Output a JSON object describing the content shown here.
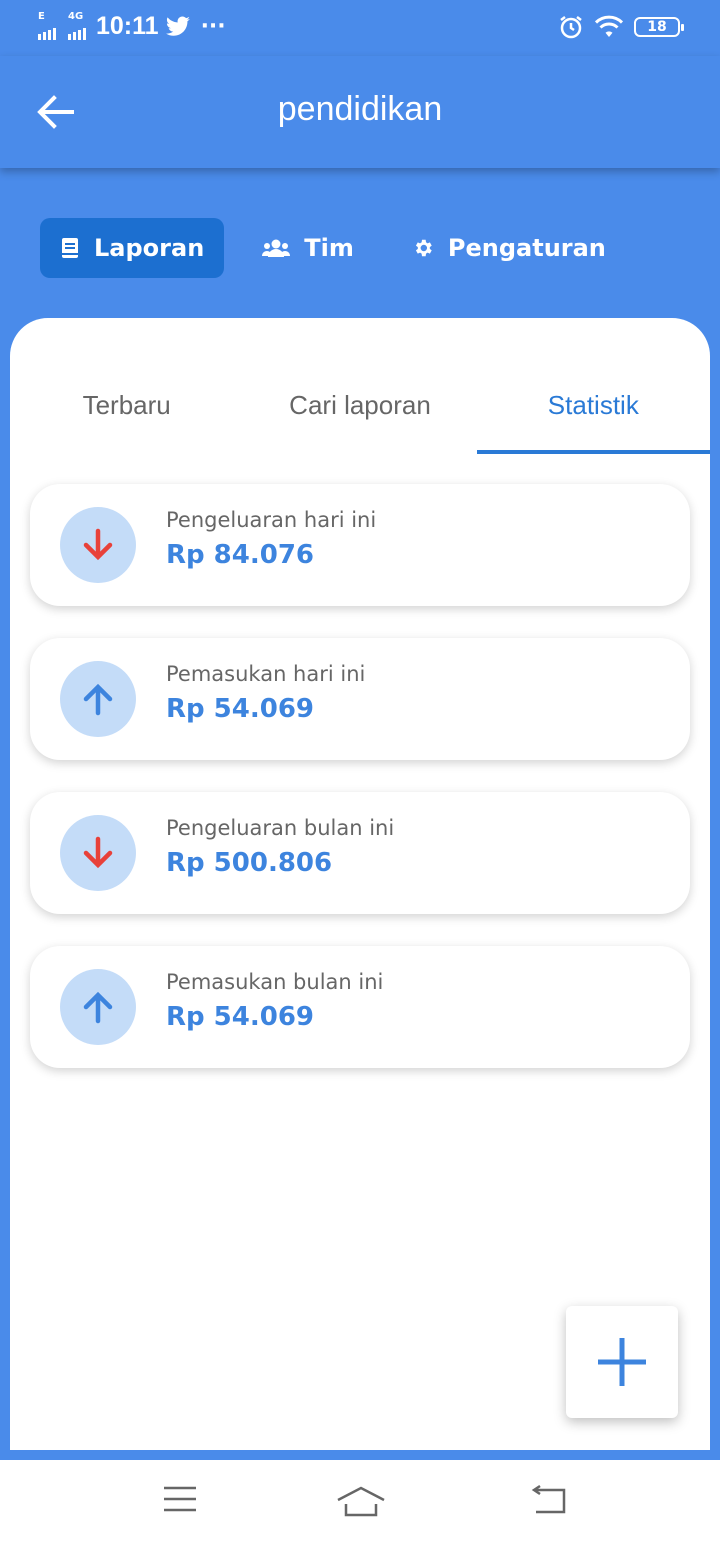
{
  "status_bar": {
    "net1": "E",
    "net2": "4G",
    "time": "10:11",
    "dots": "···",
    "battery": "18",
    "icons": [
      "signal-icon",
      "twitter-icon",
      "alarm-icon",
      "wifi-icon",
      "battery-icon"
    ]
  },
  "app_bar": {
    "title": "pendidikan",
    "back_icon": "arrow-left-icon"
  },
  "top_nav": [
    {
      "label": "Laporan",
      "icon": "book-icon",
      "active": true
    },
    {
      "label": "Tim",
      "icon": "users-icon",
      "active": false
    },
    {
      "label": "Pengaturan",
      "icon": "gear-icon",
      "active": false
    }
  ],
  "tabs": [
    {
      "label": "Terbaru",
      "active": false
    },
    {
      "label": "Cari laporan",
      "active": false
    },
    {
      "label": "Statistik",
      "active": true
    }
  ],
  "stats": [
    {
      "label": "Pengeluaran hari ini",
      "value": "Rp 84.076",
      "direction": "down"
    },
    {
      "label": "Pemasukan hari ini",
      "value": "Rp 54.069",
      "direction": "up"
    },
    {
      "label": "Pengeluaran bulan ini",
      "value": "Rp 500.806",
      "direction": "down"
    },
    {
      "label": "Pemasukan bulan ini",
      "value": "Rp 54.069",
      "direction": "up"
    }
  ],
  "colors": {
    "primary": "#4a8bea",
    "chip_active": "#1c6fd0",
    "tab_active": "#2a7ad6",
    "value_text": "#3d84de",
    "arrow_down": "#e8413a",
    "arrow_up": "#3d84de",
    "circle_bg": "#c4dcf8"
  }
}
